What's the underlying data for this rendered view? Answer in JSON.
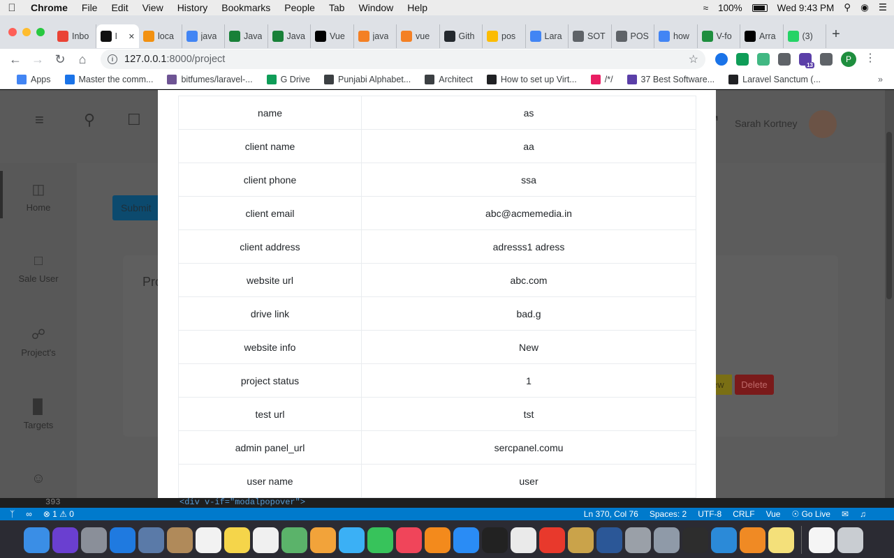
{
  "menubar": {
    "app": "Chrome",
    "items": [
      "File",
      "Edit",
      "View",
      "History",
      "Bookmarks",
      "People",
      "Tab",
      "Window",
      "Help"
    ],
    "battery": "100%",
    "clock": "Wed 9:43 PM"
  },
  "tabs": [
    {
      "label": "Inbo",
      "icon": "gmail-icon",
      "color": "#ea4335"
    },
    {
      "label": "I",
      "icon": "bow-icon",
      "color": "#111111",
      "active": true
    },
    {
      "label": "loca",
      "icon": "phpmyadmin-icon",
      "color": "#f29111"
    },
    {
      "label": "java",
      "icon": "google-icon",
      "color": "#4285f4"
    },
    {
      "label": "Java",
      "icon": "link-icon",
      "color": "#188038"
    },
    {
      "label": "Java",
      "icon": "link-icon",
      "color": "#188038"
    },
    {
      "label": "Vue",
      "icon": "medium-icon",
      "color": "#000000"
    },
    {
      "label": "java",
      "icon": "stackoverflow-icon",
      "color": "#f48024"
    },
    {
      "label": "vue",
      "icon": "stackoverflow-icon",
      "color": "#f48024"
    },
    {
      "label": "Gith",
      "icon": "github-icon",
      "color": "#24292e"
    },
    {
      "label": "pos",
      "icon": "drive-icon",
      "color": "#fbbc04"
    },
    {
      "label": "Lara",
      "icon": "docs-icon",
      "color": "#4285f4"
    },
    {
      "label": "SOT",
      "icon": "globe-icon",
      "color": "#5f6368"
    },
    {
      "label": "POS",
      "icon": "globe-icon",
      "color": "#5f6368"
    },
    {
      "label": "how",
      "icon": "google-icon",
      "color": "#4285f4"
    },
    {
      "label": "V-fo",
      "icon": "vuetify-icon",
      "color": "#1e8e3e"
    },
    {
      "label": "Arra",
      "icon": "codepen-icon",
      "color": "#000000"
    },
    {
      "label": "(3)",
      "icon": "whatsapp-icon",
      "color": "#25d366"
    }
  ],
  "toolbar": {
    "url_host": "127.0.0.1",
    "url_path": ":8000/project",
    "profile_initial": "P",
    "ext_badge": "13"
  },
  "bookmarks": [
    {
      "label": "Apps",
      "icon": "apps-grid-icon",
      "color": "#4285f4"
    },
    {
      "label": "Master the comm...",
      "icon": "rocket-icon",
      "color": "#1a73e8"
    },
    {
      "label": "bitfumes/laravel-...",
      "icon": "github-icon",
      "color": "#6e5494"
    },
    {
      "label": "G Drive",
      "icon": "drive-icon",
      "color": "#0f9d58"
    },
    {
      "label": "Punjabi Alphabet...",
      "icon": "globe-icon",
      "color": "#3c4043"
    },
    {
      "label": "Architect",
      "icon": "globe-icon",
      "color": "#3c4043"
    },
    {
      "label": "How to set up Virt...",
      "icon": "link-icon",
      "color": "#202124"
    },
    {
      "label": "/*/",
      "icon": "m-icon",
      "color": "#e91e63"
    },
    {
      "label": "37 Best Software...",
      "icon": "colorlib-icon",
      "color": "#5b3fa8"
    },
    {
      "label": "Laravel Sanctum (...",
      "icon": "doc-icon",
      "color": "#202124"
    }
  ],
  "app": {
    "user_name": "Sarah Kortney",
    "submit_label": "Submit",
    "card_title": "Pro",
    "delete_label": "Delete",
    "view_label": "ew",
    "sidebar": [
      {
        "label": "Home",
        "icon": "store-icon"
      },
      {
        "label": "Sale User",
        "icon": "book-icon"
      },
      {
        "label": "Project's",
        "icon": "cart-icon"
      },
      {
        "label": "Targets",
        "icon": "bar-chart-icon"
      }
    ]
  },
  "modal": {
    "rows": [
      {
        "key": "name",
        "value": "as"
      },
      {
        "key": "client name",
        "value": "aa"
      },
      {
        "key": "client phone",
        "value": "ssa"
      },
      {
        "key": "client email",
        "value": "abc@acmemedia.in"
      },
      {
        "key": "client address",
        "value": "adresss1 adress"
      },
      {
        "key": "website url",
        "value": "abc.com"
      },
      {
        "key": "drive link",
        "value": "bad.g"
      },
      {
        "key": "website info",
        "value": "New"
      },
      {
        "key": "project status",
        "value": "1"
      },
      {
        "key": "test url",
        "value": "tst"
      },
      {
        "key": "admin panel_url",
        "value": "sercpanel.comu"
      },
      {
        "key": "user name",
        "value": "user"
      }
    ]
  },
  "vscode": {
    "line_number": "393",
    "code_line": "<div v-if=\"modalpopover\">",
    "errors": "1",
    "warnings": "0",
    "cursor": "Ln 370, Col 76",
    "spaces": "Spaces: 2",
    "encoding": "UTF-8",
    "eol": "CRLF",
    "language": "Vue",
    "golive": "Go Live"
  },
  "dock": [
    {
      "icon": "finder-icon",
      "color": "#3a8ee6"
    },
    {
      "icon": "siri-icon",
      "color": "#6a3fd0"
    },
    {
      "icon": "launchpad-icon",
      "color": "#8a8f99"
    },
    {
      "icon": "safari-icon",
      "color": "#1f7ae0"
    },
    {
      "icon": "preview-icon",
      "color": "#5a7aa8"
    },
    {
      "icon": "contacts-icon",
      "color": "#b08a5a"
    },
    {
      "icon": "calendar-icon",
      "color": "#f2f2f2"
    },
    {
      "icon": "notes-icon",
      "color": "#f5d54a"
    },
    {
      "icon": "reminders-icon",
      "color": "#f0f0f0"
    },
    {
      "icon": "maps-icon",
      "color": "#5bb36a"
    },
    {
      "icon": "photos-icon",
      "color": "#f2a33a"
    },
    {
      "icon": "messages-icon",
      "color": "#3bb0f5"
    },
    {
      "icon": "facetime-icon",
      "color": "#37c35b"
    },
    {
      "icon": "music-icon",
      "color": "#f0455a"
    },
    {
      "icon": "books-icon",
      "color": "#f38a1c"
    },
    {
      "icon": "appstore-icon",
      "color": "#2a8cf5"
    },
    {
      "icon": "terminal-icon",
      "color": "#222222"
    },
    {
      "icon": "chrome-icon",
      "color": "#eaeaea"
    },
    {
      "icon": "anydesk-icon",
      "color": "#e8392c"
    },
    {
      "icon": "archive-icon",
      "color": "#caa34a"
    },
    {
      "icon": "word-icon",
      "color": "#2b5797"
    },
    {
      "icon": "settings-icon",
      "color": "#9aa0a8"
    },
    {
      "icon": "screenshot-icon",
      "color": "#8f9aa8"
    },
    {
      "icon": "activity-monitor-icon",
      "color": "#2d2d2d"
    },
    {
      "icon": "vscode-icon",
      "color": "#2b8ad8"
    },
    {
      "icon": "sublime-icon",
      "color": "#f08a24"
    },
    {
      "icon": "stickies-icon",
      "color": "#f4e07a"
    },
    {
      "icon": "file-icon",
      "color": "#f5f5f5"
    },
    {
      "icon": "trash-icon",
      "color": "#c9cdd2"
    }
  ]
}
